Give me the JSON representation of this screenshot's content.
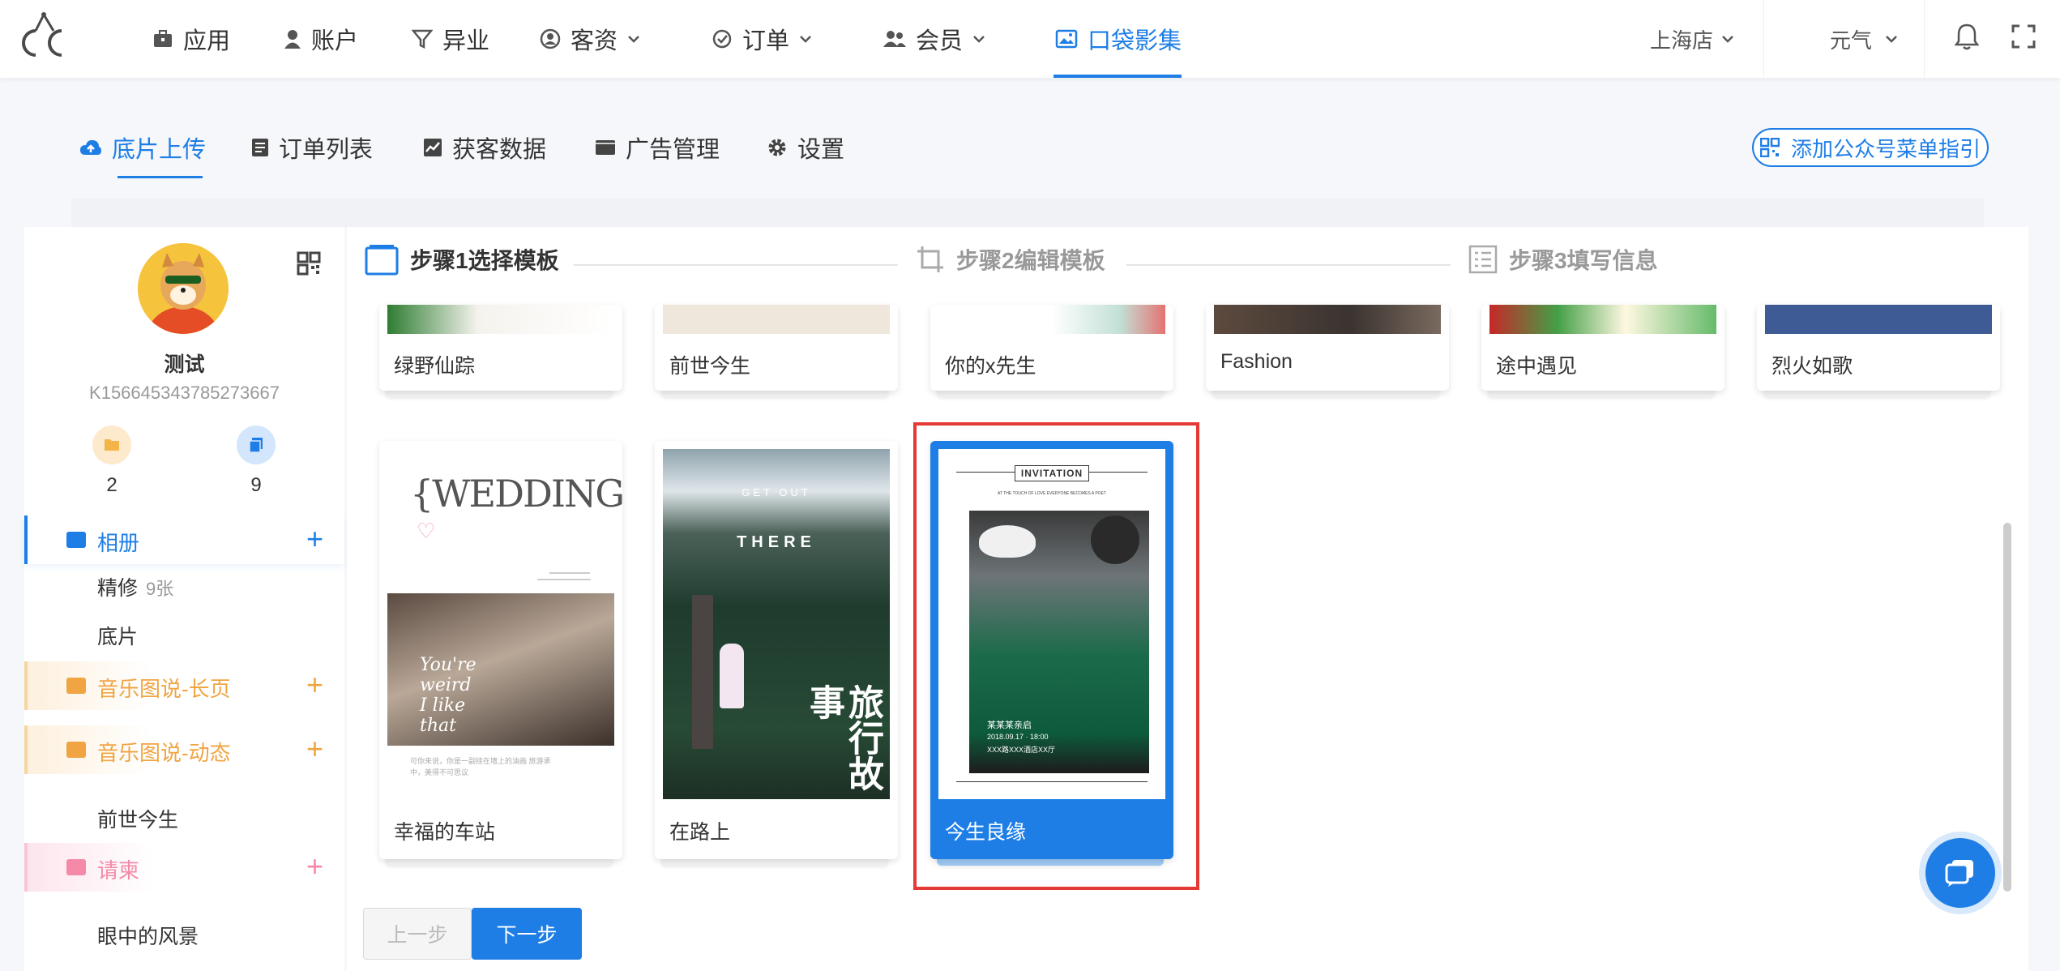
{
  "top_nav": {
    "items": [
      {
        "label": "应用",
        "icon": "briefcase-icon"
      },
      {
        "label": "账户",
        "icon": "user-icon"
      },
      {
        "label": "异业",
        "icon": "filter-icon"
      },
      {
        "label": "客资",
        "icon": "customer-icon",
        "dropdown": true
      },
      {
        "label": "订单",
        "icon": "check-circle-icon",
        "dropdown": true
      },
      {
        "label": "会员",
        "icon": "members-icon",
        "dropdown": true
      },
      {
        "label": "口袋影集",
        "icon": "album-icon",
        "active": true
      }
    ],
    "store": "上海店",
    "user": "元气"
  },
  "sub_nav": {
    "items": [
      {
        "label": "底片上传",
        "icon": "cloud-upload-icon",
        "active": true
      },
      {
        "label": "订单列表",
        "icon": "list-icon"
      },
      {
        "label": "获客数据",
        "icon": "chart-icon"
      },
      {
        "label": "广告管理",
        "icon": "ad-icon"
      },
      {
        "label": "设置",
        "icon": "gear-icon"
      }
    ],
    "guide_button": "添加公众号菜单指引"
  },
  "sidebar": {
    "username": "测试",
    "user_id": "K156645343785273667",
    "stats": [
      {
        "value": "2",
        "icon": "folder-icon"
      },
      {
        "value": "9",
        "icon": "copy-icon"
      }
    ],
    "sections": [
      {
        "label": "相册",
        "color": "#1e7ee6"
      },
      {
        "label": "音乐图说-长页",
        "color": "#f0a442"
      },
      {
        "label": "音乐图说-动态",
        "color": "#f0a442"
      },
      {
        "label": "请柬",
        "color": "#f48aa7"
      }
    ],
    "subitems": [
      {
        "label": "精修",
        "count": "9张"
      },
      {
        "label": "底片"
      },
      {
        "label": "前世今生"
      },
      {
        "label": "眼中的风景"
      }
    ]
  },
  "steps": [
    {
      "label": "步骤1选择模板",
      "active": true
    },
    {
      "label": "步骤2编辑模板"
    },
    {
      "label": "步骤3填写信息"
    }
  ],
  "templates_row1": [
    "绿野仙踪",
    "前世今生",
    "你的x先生",
    "Fashion",
    "途中遇见",
    "烈火如歌"
  ],
  "templates_row2": [
    {
      "label": "幸福的车站",
      "art": {
        "title": "{WEDDING}",
        "script": [
          "You're",
          "weird",
          "I like",
          "that"
        ],
        "caption": "可你来说，你是一副挂在墙上的油画 旅游承中，美得不可思议"
      }
    },
    {
      "label": "在路上",
      "art": {
        "line1": "GET OUT",
        "line2": "THERE",
        "brush": "旅行故事"
      }
    },
    {
      "label": "今生良缘",
      "selected": true,
      "art": {
        "banner": "INVITATION",
        "tagline": "AT THE TOUCH OF LOVE EVERYONE BECOMES A POET",
        "names": "某某某亲启",
        "date": "2018.09.17 · 18:00",
        "venue": "XXX路XXX酒店XX厅"
      }
    }
  ],
  "buttons": {
    "prev": "上一步",
    "next": "下一步"
  }
}
